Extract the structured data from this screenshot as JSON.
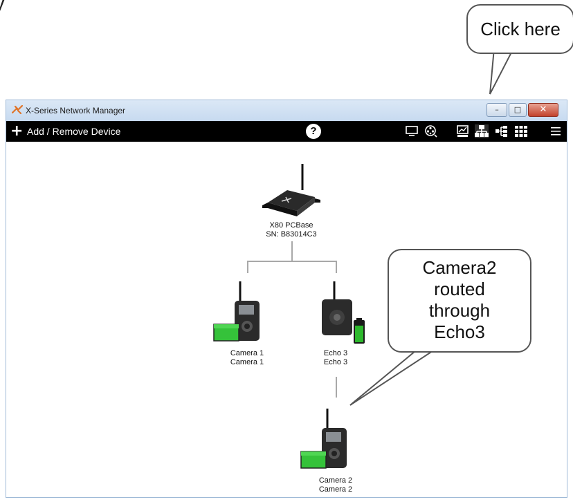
{
  "top_cut_text": "y",
  "callouts": {
    "toolbar_hint": "Click here",
    "routing_note": [
      "Camera2",
      "routed",
      "through",
      "Echo3"
    ]
  },
  "window": {
    "title": "X-Series Network Manager",
    "controls": {
      "minimize": "–",
      "maximize": "□",
      "close": "✕"
    }
  },
  "toolbar": {
    "add_remove_label": "Add / Remove Device",
    "add_icon": "plus-icon",
    "help_label": "?",
    "icons": [
      "monitor-icon",
      "film-reel-icon",
      "chart-icon",
      "network-tree-icon",
      "branch-icon",
      "grid-icon",
      "menu-icon"
    ]
  },
  "devices": {
    "base": {
      "name": "X80 PCBase",
      "serial": "SN: B83014C3"
    },
    "camera1": {
      "line1": "Camera 1",
      "line2": "Camera 1"
    },
    "echo3": {
      "line1": "Echo 3",
      "line2": "Echo 3"
    },
    "camera2": {
      "line1": "Camera 2",
      "line2": "Camera 2"
    }
  },
  "colors": {
    "toolbar_bg": "#000000",
    "battery_green": "#2db92d",
    "link_gray": "#a8a8a8"
  }
}
